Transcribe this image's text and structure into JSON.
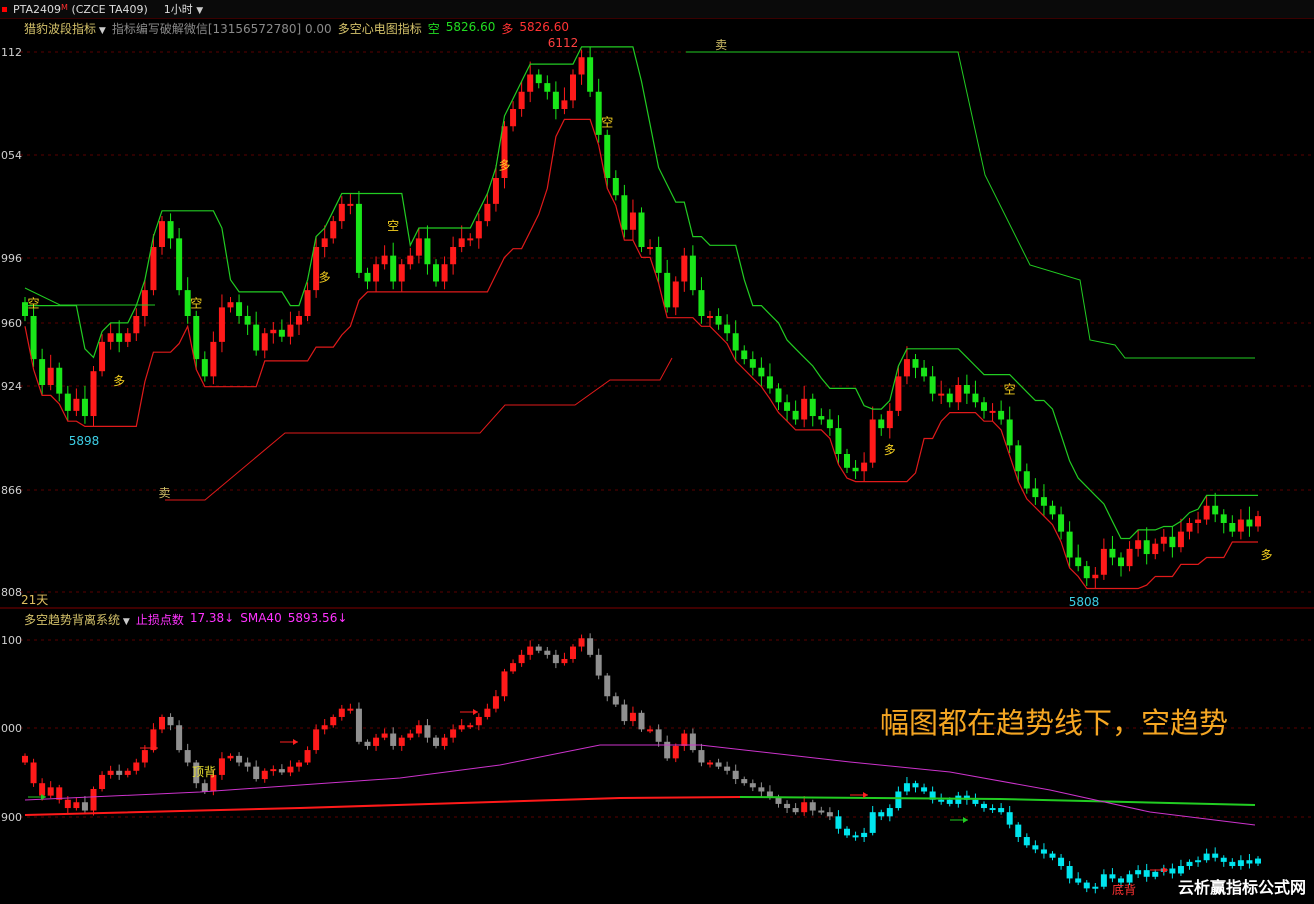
{
  "header": {
    "symbol": "PTA2409",
    "symbol_sup": "M",
    "exchange_code": "(CZCE TA409)",
    "period": "1小时"
  },
  "main_panel": {
    "indicator_name": "猎豹波段指标",
    "indicator_desc": "指标编写破解微信[13156572780] 0.00",
    "indicator2_name": "多空心电图指标",
    "short_label": "空",
    "short_value": "5826.60",
    "long_label": "多",
    "long_value": "5826.60",
    "y_ticks": [
      "112",
      "054",
      "996",
      "960",
      "924",
      "866",
      "808"
    ],
    "bottom_left_label": "21天",
    "low_label": "5898",
    "low_label2": "5808",
    "high_label": "6112",
    "signals": [
      {
        "text": "空",
        "i": 1
      },
      {
        "text": "多",
        "i": 11
      },
      {
        "text": "空",
        "i": 20
      },
      {
        "text": "多",
        "i": 35
      },
      {
        "text": "空",
        "i": 43
      },
      {
        "text": "多",
        "i": 56
      },
      {
        "text": "空",
        "i": 68
      },
      {
        "text": "多",
        "i": 101
      },
      {
        "text": "空",
        "i": 115
      },
      {
        "text": "多",
        "i": 145
      }
    ],
    "sell_labels": [
      {
        "text": "卖",
        "i": 17
      },
      {
        "text": "卖",
        "i": 82
      }
    ]
  },
  "sub_panel": {
    "indicator_name": "多空趋势背离系统",
    "stop_label": "止损点数",
    "stop_value": "17.38↓",
    "sma_label": "SMA40",
    "sma_value": "5893.56↓",
    "y_ticks": [
      "100",
      "000",
      "900"
    ],
    "top_div_label": "顶背",
    "bottom_div_label": "底背"
  },
  "annotation": "幅图都在趋势线下，空趋势",
  "watermark": "云析赢指标公式网",
  "colors": {
    "bull": "#ff1a1a",
    "bear": "#19e619",
    "neutral": "#909090",
    "cyan": "#00e5ee",
    "trend_green": "#22cc22",
    "stop_red": "#e01a1a",
    "sma": "#cc33cc",
    "grid": "#5a0000"
  },
  "chart_data": {
    "type": "candlestick",
    "y_range_main": [
      5800,
      6120
    ],
    "closes": [
      5960,
      5935,
      5920,
      5930,
      5915,
      5905,
      5912,
      5902,
      5928,
      5945,
      5950,
      5945,
      5950,
      5960,
      5975,
      6000,
      6015,
      6005,
      5975,
      5960,
      5935,
      5925,
      5945,
      5965,
      5968,
      5960,
      5955,
      5940,
      5950,
      5952,
      5948,
      5955,
      5960,
      5975,
      6000,
      6005,
      6015,
      6025,
      6025,
      5985,
      5980,
      5990,
      5995,
      5980,
      5990,
      5995,
      6005,
      5990,
      5980,
      5990,
      6000,
      6005,
      6005,
      6015,
      6025,
      6040,
      6070,
      6080,
      6090,
      6100,
      6095,
      6090,
      6080,
      6085,
      6100,
      6110,
      6090,
      6065,
      6040,
      6030,
      6010,
      6020,
      6000,
      6000,
      5985,
      5965,
      5980,
      5995,
      5975,
      5960,
      5960,
      5955,
      5950,
      5940,
      5935,
      5930,
      5925,
      5918,
      5910,
      5905,
      5900,
      5912,
      5902,
      5900,
      5895,
      5880,
      5872,
      5870,
      5875,
      5900,
      5895,
      5905,
      5925,
      5935,
      5930,
      5925,
      5915,
      5915,
      5910,
      5920,
      5915,
      5910,
      5905,
      5905,
      5900,
      5885,
      5870,
      5860,
      5855,
      5850,
      5845,
      5835,
      5820,
      5815,
      5808,
      5810,
      5825,
      5820,
      5815,
      5825,
      5830,
      5822,
      5828,
      5832,
      5826,
      5835,
      5840,
      5842,
      5850,
      5845,
      5840,
      5835,
      5842,
      5838,
      5844
    ],
    "stop_values": [
      5826.6
    ],
    "sma40": 5893.56
  }
}
